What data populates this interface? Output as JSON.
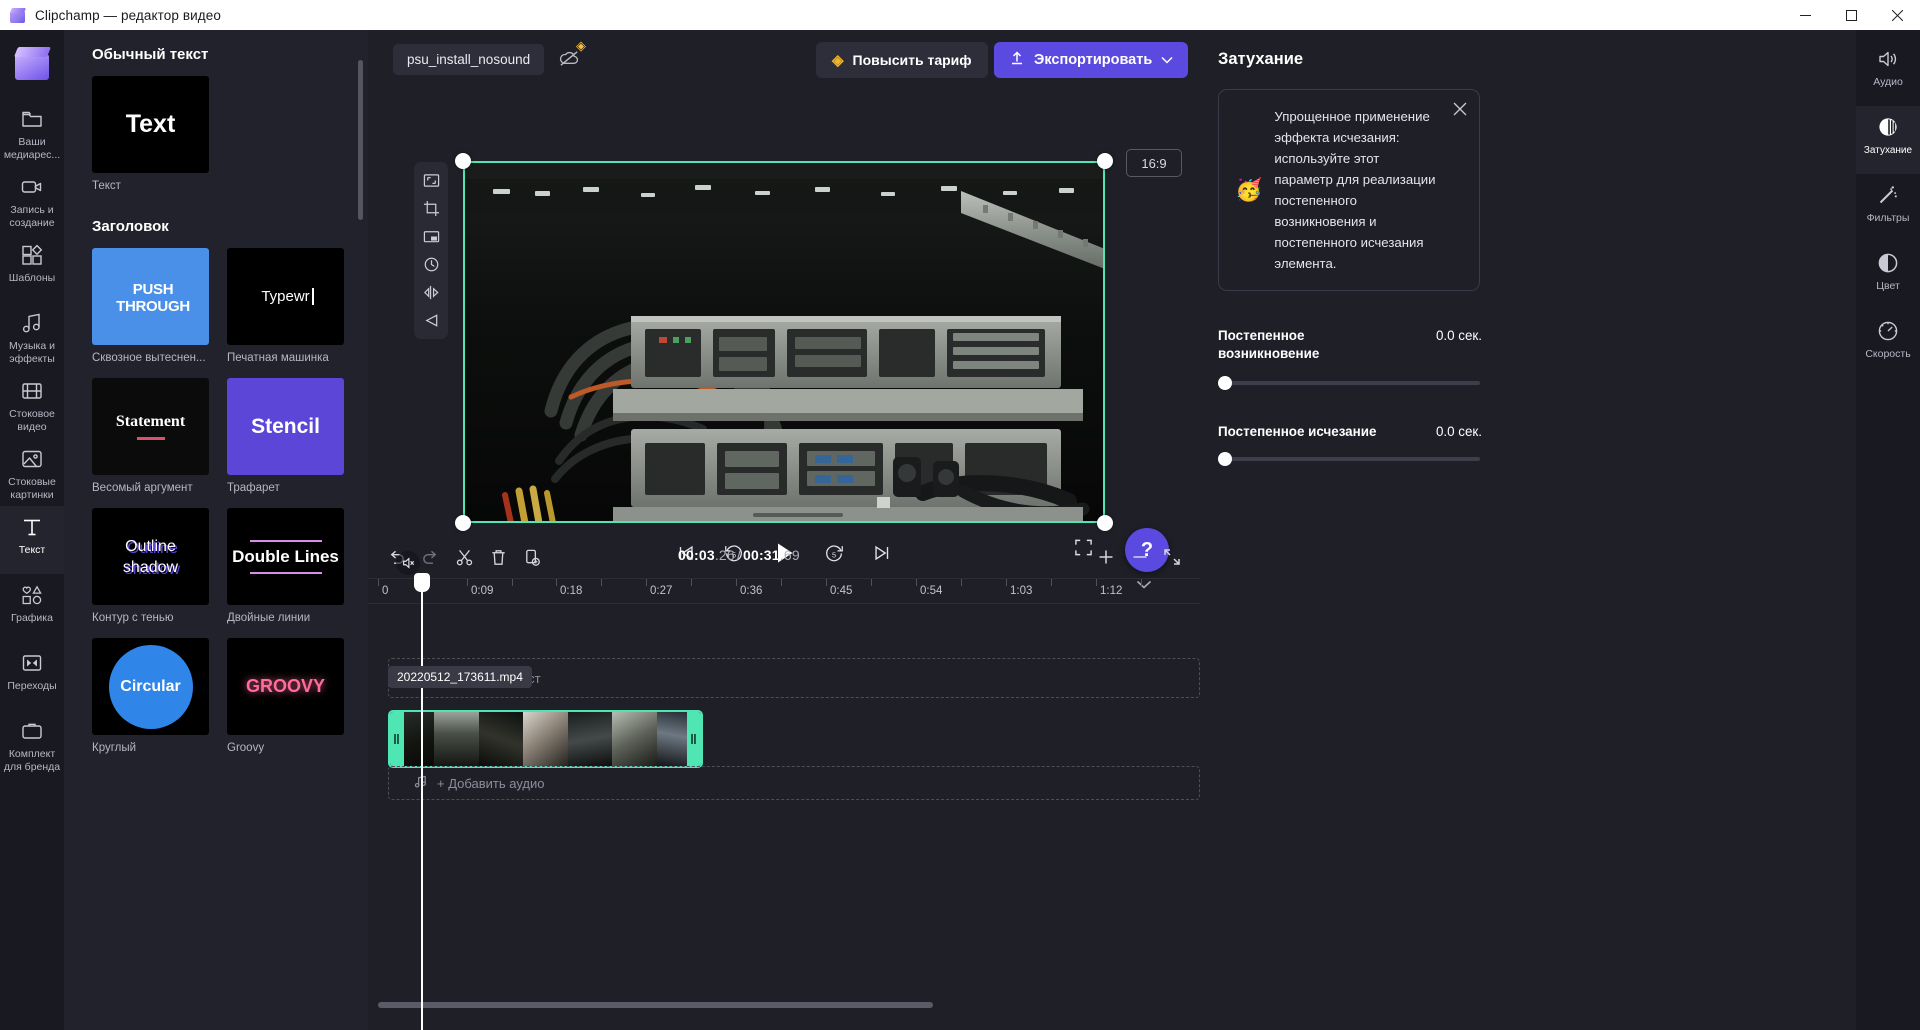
{
  "window": {
    "title": "Clipchamp — редактор видео",
    "controls": {
      "minimize": "minimize-icon",
      "maximize": "maximize-icon",
      "close": "close-icon"
    }
  },
  "left_rail": {
    "logo": "clipchamp-logo",
    "items": [
      {
        "label": "Ваши медиарес...",
        "icon": "folder-icon",
        "active": false
      },
      {
        "label": "Запись и создание",
        "icon": "camera-icon",
        "active": false
      },
      {
        "label": "Шаблоны",
        "icon": "templates-icon",
        "active": false
      },
      {
        "label": "Музыка и эффекты",
        "icon": "music-icon",
        "active": false
      },
      {
        "label": "Стоковое видео",
        "icon": "film-icon",
        "active": false
      },
      {
        "label": "Стоковые картинки",
        "icon": "image-icon",
        "active": false
      },
      {
        "label": "Текст",
        "icon": "text-icon",
        "active": true
      },
      {
        "label": "Графика",
        "icon": "shapes-icon",
        "active": false
      },
      {
        "label": "Переходы",
        "icon": "transitions-icon",
        "active": false
      },
      {
        "label": "Комплект для бренда",
        "icon": "brand-kit-icon",
        "active": false
      }
    ]
  },
  "templates_panel": {
    "sections": [
      {
        "title": "Обычный текст",
        "cards": [
          {
            "name": "Текст",
            "preview_text": "Text",
            "bg": "#000000",
            "color": "#ffffff",
            "style": "plain"
          }
        ]
      },
      {
        "title": "Заголовок",
        "cards": [
          {
            "name": "Сквозное вытеснен...",
            "preview_text": "PUSH THROUGH",
            "bg": "#4a90e8",
            "color": "#ffffff",
            "style": "push"
          },
          {
            "name": "Печатная машинка",
            "preview_text": "Typewr",
            "bg": "#000000",
            "color": "#ffffff",
            "style": "typewriter"
          },
          {
            "name": "Весомый аргумент",
            "preview_text": "Statement",
            "bg": "#0b0b0b",
            "color": "#ffffff",
            "style": "statement"
          },
          {
            "name": "Трафарет",
            "preview_text": "Stencil",
            "bg": "#5b46d8",
            "color": "#ffffff",
            "style": "stencil"
          },
          {
            "name": "Контур с тенью",
            "preview_text": "Outline shadow",
            "bg": "#000000",
            "color": "#ffffff",
            "style": "outline"
          },
          {
            "name": "Двойные линии",
            "preview_text": "Double Lines",
            "bg": "#000000",
            "color": "#ffffff",
            "style": "doubleline"
          },
          {
            "name": "Круглый",
            "preview_text": "Circular",
            "bg": "#000000",
            "color": "#ffffff",
            "style": "circular"
          },
          {
            "name": "Groovy",
            "preview_text": "GROOVY",
            "bg": "#000000",
            "color": "#ff6b9a",
            "style": "groovy"
          }
        ]
      }
    ]
  },
  "top_bar": {
    "project_name": "psu_install_nosound",
    "cloud_icon": "cloud-off-icon",
    "gem_icon": "gem-icon",
    "upgrade_label": "Повысить тариф",
    "export_label": "Экспортировать"
  },
  "preview": {
    "aspect_ratio": "16:9",
    "edit_tools": [
      "fit-to-screen-icon",
      "crop-icon",
      "picture-in-picture-icon",
      "rotate-icon",
      "flip-icon",
      "mask-icon"
    ],
    "transport": [
      "skip-to-start-icon",
      "rewind-5-icon",
      "play-icon",
      "forward-5-icon",
      "skip-to-end-icon"
    ],
    "fullscreen_icon": "fullscreen-icon",
    "help_label": "?",
    "collapse_icon": "chevron-down-icon"
  },
  "timeline": {
    "tools": [
      "undo-icon",
      "redo-icon",
      "split-icon",
      "delete-icon",
      "duplicate-icon"
    ],
    "current_time": "00:03",
    "current_frac": ".26",
    "total_time": "00:31",
    "total_frac": ".69",
    "separator": "/",
    "zoom_in_icon": "plus-icon",
    "zoom_out_icon": "minus-icon",
    "fit_icon": "fit-timeline-icon",
    "ruler_ticks": [
      "0",
      "0:09",
      "0:18",
      "0:27",
      "0:36",
      "0:45",
      "0:54",
      "1:03",
      "1:12"
    ],
    "text_track_placeholder": "+ Добавить текст",
    "audio_track_placeholder": "+ Добавить аудио",
    "text_track_icon": "text-track-icon",
    "audio_track_icon": "audio-track-icon",
    "clip_tooltip": "20220512_173611.mp4",
    "clip_mute_icon": "muted-icon"
  },
  "properties": {
    "title": "Затухание",
    "tip": {
      "emoji": "🥳",
      "text": "Упрощенное применение эффекта исчезания: используйте этот параметр для реализации постепенного возникновения и постепенного исчезания элемента.",
      "close_icon": "close-icon"
    },
    "fade_in": {
      "label": "Постепенное возникновение",
      "value": "0.0 сек.",
      "slider_pct": 0
    },
    "fade_out": {
      "label": "Постепенное исчезание",
      "value": "0.0 сек.",
      "slider_pct": 0
    }
  },
  "right_rail": {
    "items": [
      {
        "label": "Аудио",
        "icon": "speaker-icon",
        "active": false
      },
      {
        "label": "Затухание",
        "icon": "fade-icon",
        "active": true
      },
      {
        "label": "Фильтры",
        "icon": "magic-wand-icon",
        "active": false
      },
      {
        "label": "Цвет",
        "icon": "contrast-icon",
        "active": false
      },
      {
        "label": "Скорость",
        "icon": "speedometer-icon",
        "active": false
      }
    ]
  },
  "colors": {
    "accent": "#5b4ae0",
    "selection": "#4fe6b4",
    "panel_bg": "#22222c",
    "rail_bg": "#191922",
    "canvas_bg": "#1f1f28"
  }
}
